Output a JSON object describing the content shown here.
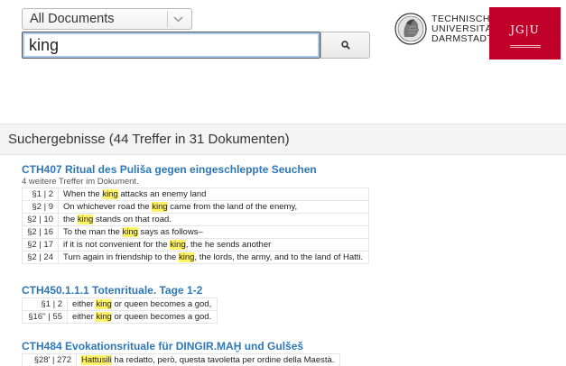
{
  "search": {
    "doc_scope": "All Documents",
    "query": "king"
  },
  "logos": {
    "tud": [
      "TECHNISCHE",
      "UNIVERSITÄT",
      "DARMSTADT"
    ],
    "jgu": "JG|U"
  },
  "results_summary": "Suchergebnisse (44 Treffer in 31 Dokumenten)",
  "groups": [
    {
      "title": "CTH407 Ritual des Puliša gegen eingeschleppte Seuchen",
      "subtitle": "4 weitere Treffer im Dokument.",
      "hits": [
        {
          "ref": "§1 | 2",
          "pre": "When the ",
          "hit": "king",
          "post": " attacks an enemy land"
        },
        {
          "ref": "§2 | 9",
          "pre": "On whichever road the ",
          "hit": "king",
          "post": " came from the land of the enemy,"
        },
        {
          "ref": "§2 | 10",
          "pre": "the ",
          "hit": "king",
          "post": " stands on that road."
        },
        {
          "ref": "§2 | 16",
          "pre": "To the man the ",
          "hit": "king",
          "post": " says as follows–"
        },
        {
          "ref": "§2 | 17",
          "pre": "if it is not convenient for the ",
          "hit": "king",
          "post": ", the he sends another"
        },
        {
          "ref": "§2 | 24",
          "pre": "Turn again in friendship to the ",
          "hit": "king",
          "post": ", the lords, the army, and to the land of Hatti."
        }
      ]
    },
    {
      "title": "CTH450.1.1.1 Totenrituale. Tage 1-2",
      "subtitle": "",
      "hits": [
        {
          "ref": "§1 | 2",
          "pre": "either ",
          "hit": "king",
          "post": " or queen becomes a god,"
        },
        {
          "ref": "§16'' | 55",
          "pre": "either ",
          "hit": "king",
          "post": " or queen becomes a god."
        }
      ]
    },
    {
      "title": "CTH484 Evokationsrituale für DINGIR.MAḪ und Gulšeš",
      "subtitle": "",
      "hits": [
        {
          "ref": "§28' | 272",
          "pre": "",
          "hit": "Hattusili",
          "post": " ha redatto, però, questa tavoletta per ordine della Maestà."
        }
      ]
    }
  ],
  "colors": {
    "link": "#2e77b8",
    "highlight": "#fff266",
    "jgu_red": "#c1002a"
  },
  "icons": {
    "dropdown": "chevron-down-icon",
    "search": "search-icon"
  }
}
